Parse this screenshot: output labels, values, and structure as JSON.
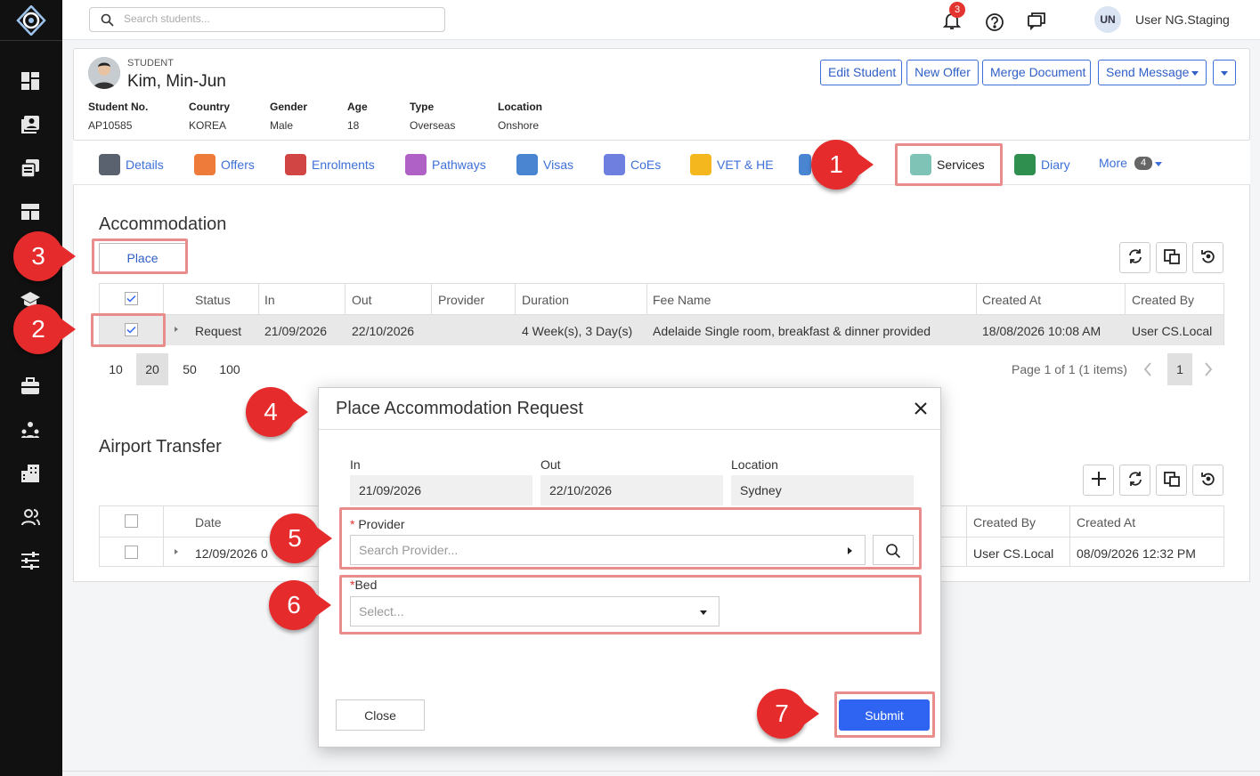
{
  "search": {
    "placeholder": "Search students..."
  },
  "notifications": {
    "count": "3"
  },
  "user": {
    "initials": "UN",
    "name": "User NG.Staging"
  },
  "student": {
    "tag": "STUDENT",
    "name": "Kim, Min-Jun",
    "fields": [
      {
        "label": "Student No.",
        "value": "AP10585"
      },
      {
        "label": "Country",
        "value": "KOREA"
      },
      {
        "label": "Gender",
        "value": "Male"
      },
      {
        "label": "Age",
        "value": "18"
      },
      {
        "label": "Type",
        "value": "Overseas"
      },
      {
        "label": "Location",
        "value": "Onshore"
      }
    ]
  },
  "actions": {
    "edit": "Edit Student",
    "new_offer": "New Offer",
    "merge": "Merge Document",
    "send": "Send Message"
  },
  "tabs": {
    "details": "Details",
    "offers": "Offers",
    "enrolments": "Enrolments",
    "pathways": "Pathways",
    "visas": "Visas",
    "coes": "CoEs",
    "vet": "VET & HE",
    "services": "Services",
    "diary": "Diary",
    "more": "More",
    "more_count": "4"
  },
  "accommodation": {
    "title": "Accommodation",
    "place_label": "Place",
    "columns": [
      "Status",
      "In",
      "Out",
      "Provider",
      "Duration",
      "Fee Name",
      "Created At",
      "Created By"
    ],
    "row": {
      "status": "Request",
      "in": "21/09/2026",
      "out": "22/10/2026",
      "provider": "",
      "duration": "4 Week(s), 3 Day(s)",
      "fee_name": "Adelaide Single room, breakfast & dinner provided",
      "created_at": "18/08/2026 10:08 AM",
      "created_by": "User CS.Local"
    },
    "page_sizes": [
      "10",
      "20",
      "50",
      "100"
    ],
    "page_info": "Page 1 of 1 (1 items)",
    "current_page": "1"
  },
  "airport": {
    "title": "Airport Transfer",
    "columns": {
      "date": "Date",
      "created_by": "Created By",
      "created_at": "Created At"
    },
    "row": {
      "date": "12/09/2026 0",
      "created_by": "User CS.Local",
      "created_at": "08/09/2026 12:32 PM"
    }
  },
  "modal": {
    "title": "Place Accommodation Request",
    "in_label": "In",
    "in_value": "21/09/2026",
    "out_label": "Out",
    "out_value": "22/10/2026",
    "location_label": "Location",
    "location_value": "Sydney",
    "provider_label": "Provider",
    "provider_placeholder": "Search Provider...",
    "bed_label": "Bed",
    "bed_placeholder": "Select...",
    "close_label": "Close",
    "submit_label": "Submit"
  },
  "callouts": [
    "1",
    "2",
    "3",
    "4",
    "5",
    "6",
    "7"
  ],
  "colors": {
    "accent": "#2f64f2",
    "callout": "#e52b2b",
    "highlight": "#e88c8c",
    "sidebar": "#111111"
  }
}
